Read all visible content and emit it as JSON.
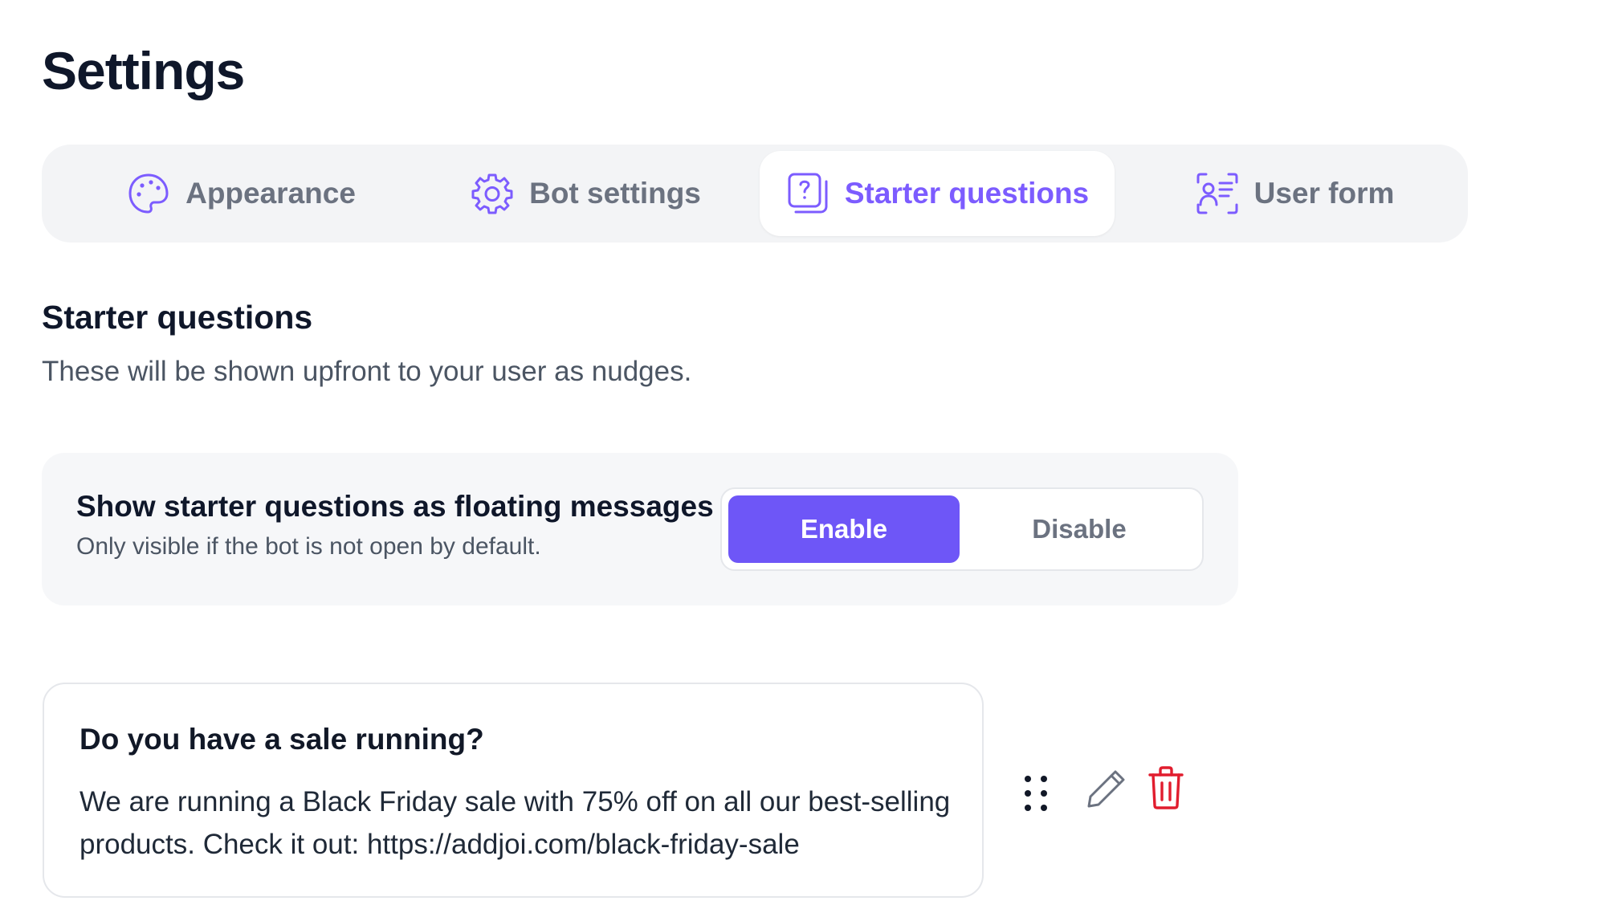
{
  "page": {
    "title": "Settings"
  },
  "tabs": [
    {
      "label": "Appearance",
      "icon": "palette-icon",
      "active": false
    },
    {
      "label": "Bot settings",
      "icon": "gear-icon",
      "active": false
    },
    {
      "label": "Starter questions",
      "icon": "question-stack-icon",
      "active": true
    },
    {
      "label": "User form",
      "icon": "user-form-icon",
      "active": false
    }
  ],
  "section": {
    "title": "Starter questions",
    "description": "These will be shown upfront to your user as nudges."
  },
  "floating_option": {
    "label": "Show starter questions as floating messages",
    "sublabel": "Only visible if the bot is not open by default.",
    "enable_label": "Enable",
    "disable_label": "Disable",
    "selected": "Enable"
  },
  "questions": [
    {
      "question": "Do you have a sale running?",
      "answer": "We are running a Black Friday sale with 75% off on all our best-selling products. Check it out: https://addjoi.com/black-friday-sale"
    }
  ],
  "icons": {
    "drag": "drag-handle-icon",
    "edit": "pencil-icon",
    "delete": "trash-icon"
  },
  "colors": {
    "accent": "#6e56f7",
    "accent_text": "#7c5cff",
    "muted_text": "#6b7280",
    "tab_bar_bg": "#f3f4f6",
    "card_bg": "#f6f7f9",
    "danger": "#e11d2e"
  }
}
